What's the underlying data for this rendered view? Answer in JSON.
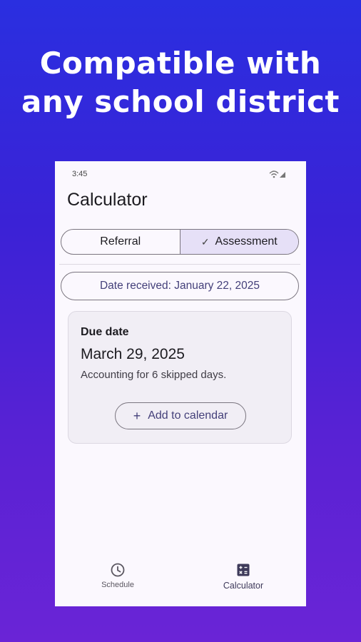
{
  "headline": {
    "line1": "Compatible with",
    "line2": "any school district"
  },
  "status_bar": {
    "time": "3:45",
    "icons": [
      "wifi-icon",
      "signal-icon"
    ]
  },
  "app": {
    "title": "Calculator"
  },
  "segmented": {
    "options": [
      {
        "label": "Referral",
        "selected": false
      },
      {
        "label": "Assessment",
        "selected": true
      }
    ]
  },
  "date_received": {
    "label": "Date received: January 22, 2025"
  },
  "result_card": {
    "label": "Due date",
    "date": "March 29, 2025",
    "note": "Accounting for 6 skipped days.",
    "add_button": "Add to calendar"
  },
  "bottom_nav": {
    "items": [
      {
        "label": "Schedule",
        "icon": "clock-icon",
        "active": false
      },
      {
        "label": "Calculator",
        "icon": "calculator-icon",
        "active": true
      }
    ]
  },
  "colors": {
    "background_top": "#2a2fe0",
    "background_bottom": "#6a24d6",
    "selected_segment": "#e6e0f7",
    "accent_text": "#44407a"
  }
}
